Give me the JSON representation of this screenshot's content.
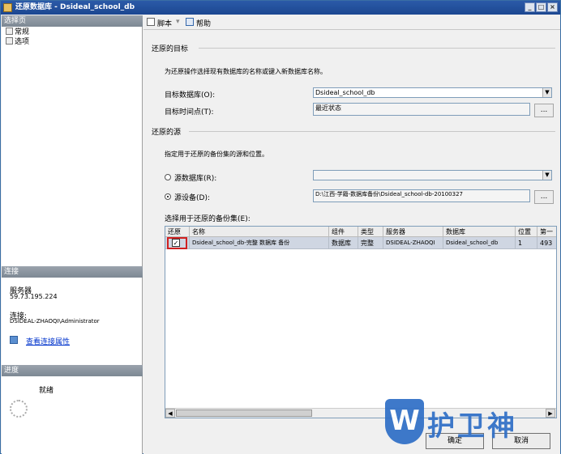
{
  "window": {
    "title": "还原数据库 - Dsideal_school_db"
  },
  "left": {
    "select_page_header": "选择页",
    "pages": [
      {
        "label": "常规"
      },
      {
        "label": "选项"
      }
    ],
    "connection_header": "连接",
    "server_label": "服务器",
    "server_value": "59.73.195.224",
    "connection_label": "连接:",
    "connection_value": "DSIDEAL-ZHAOQI\\Administrator",
    "view_props_link": "查看连接属性",
    "progress_header": "进度",
    "progress_status": "就绪"
  },
  "toolbar": {
    "script_label": "脚本",
    "help_label": "帮助"
  },
  "target": {
    "section_title": "还原的目标",
    "description": "为还原操作选择现有数据库的名称或键入新数据库名称。",
    "db_label": "目标数据库(O):",
    "db_value": "Dsideal_school_db",
    "time_label": "目标时间点(T):",
    "time_value": "最近状态",
    "ellipsis": "..."
  },
  "source": {
    "section_title": "还原的源",
    "description": "指定用于还原的备份集的源和位置。",
    "from_db_label": "源数据库(R):",
    "from_device_label": "源设备(D):",
    "device_value": "D:\\江西-学籍-数据库备份\\Dsideal_school-db-20100327",
    "ellipsis": "...",
    "selected": "device"
  },
  "backupsets": {
    "label": "选择用于还原的备份集(E):",
    "columns": [
      "还原",
      "名称",
      "组件",
      "类型",
      "服务器",
      "数据库",
      "位置",
      "第一"
    ],
    "rows": [
      {
        "restore": true,
        "name": "Dsideal_school_db-完整 数据库 备份",
        "component": "数据库",
        "type": "完整",
        "server": "DSIDEAL-ZHAOQI",
        "database": "Dsideal_school_db",
        "position": "1",
        "first": "493"
      }
    ]
  },
  "buttons": {
    "ok": "确定",
    "cancel": "取消"
  },
  "watermark": {
    "letter": "W",
    "text": "护卫神"
  }
}
